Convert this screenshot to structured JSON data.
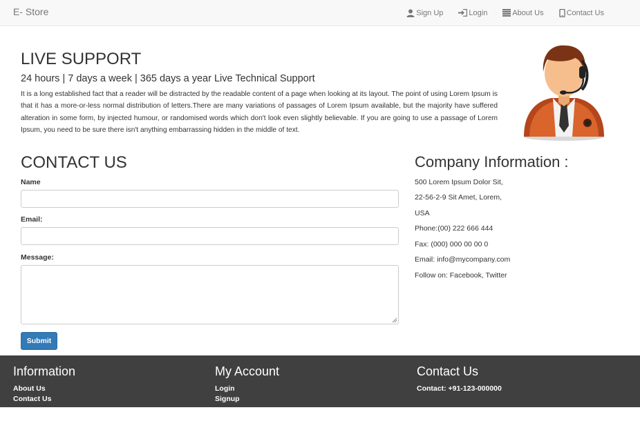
{
  "navbar": {
    "brand": "E- Store",
    "items": [
      {
        "label": "Sign Up",
        "icon": "user-icon"
      },
      {
        "label": "Login",
        "icon": "login-icon"
      },
      {
        "label": "About Us",
        "icon": "list-icon"
      },
      {
        "label": "Contact Us",
        "icon": "phone-icon"
      }
    ]
  },
  "live_support": {
    "title": "LIVE SUPPORT",
    "subtitle": "24 hours | 7 days a week | 365 days a year Live Technical Support",
    "text": "It is a long established fact that a reader will be distracted by the readable content of a page when looking at its layout. The point of using Lorem Ipsum is that it has a more-or-less normal distribution of letters.There are many variations of passages of Lorem Ipsum available, but the majority have suffered alteration in some form, by injected humour, or randomised words which don't look even slightly believable. If you are going to use a passage of Lorem Ipsum, you need to be sure there isn't anything embarrassing hidden in the middle of text."
  },
  "contact_form": {
    "title": "CONTACT US",
    "name_label": "Name",
    "name_value": "",
    "email_label": "Email:",
    "email_value": "",
    "message_label": "Message:",
    "message_value": "",
    "submit_label": "Submit"
  },
  "company": {
    "title": "Company Information :",
    "lines": [
      "500 Lorem Ipsum Dolor Sit,",
      "22-56-2-9 Sit Amet, Lorem,",
      "USA",
      "Phone:(00) 222 666 444",
      "Fax: (000) 000 00 00 0",
      "Email: info@mycompany.com",
      "Follow on: Facebook, Twitter"
    ]
  },
  "footer": {
    "information": {
      "title": "Information",
      "links": [
        "About Us",
        "Contact Us"
      ]
    },
    "my_account": {
      "title": "My Account",
      "links": [
        "Login",
        "Signup"
      ]
    },
    "contact": {
      "title": "Contact Us",
      "line": "Contact: +91-123-000000"
    }
  },
  "colors": {
    "navbar_bg": "#f8f8f8",
    "footer_bg": "#404040",
    "button_primary": "#337ab7",
    "text": "#333333",
    "nav_text": "#777777"
  }
}
